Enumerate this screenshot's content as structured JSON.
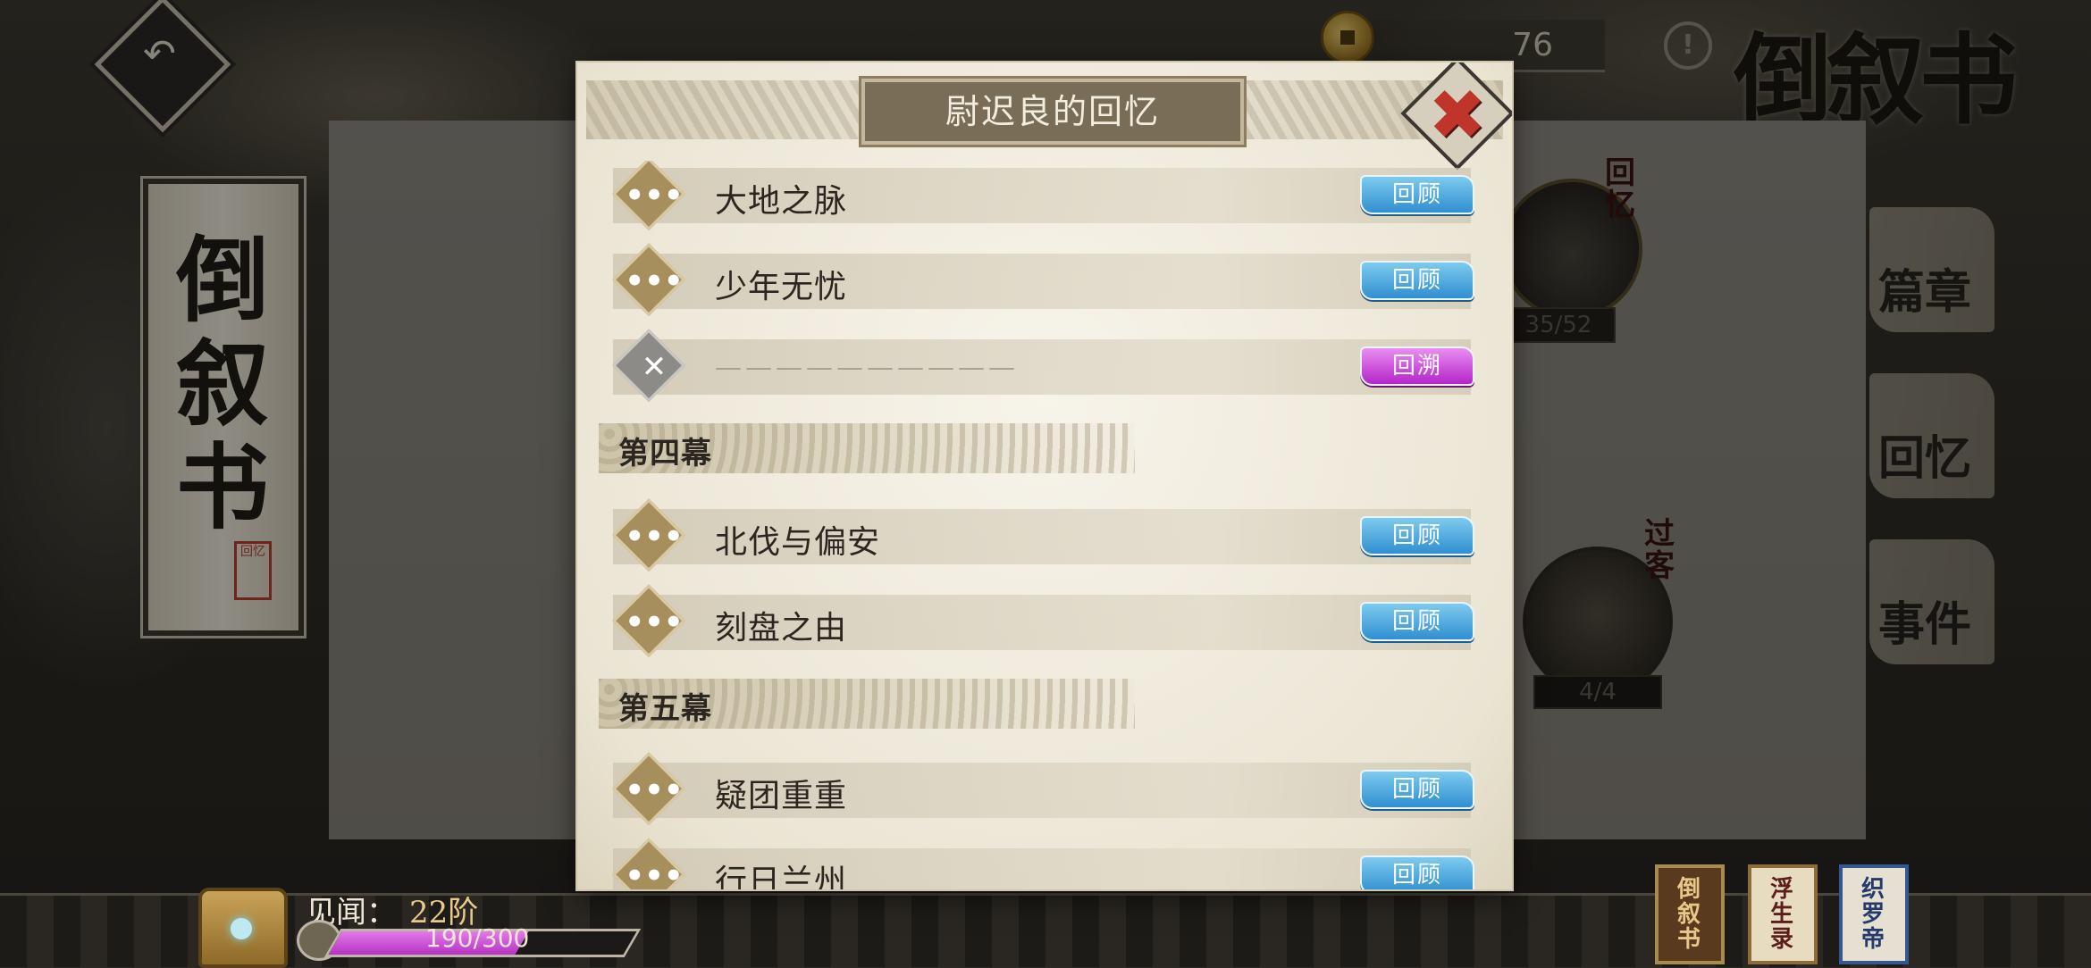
{
  "top": {
    "currency_value": "76",
    "info_glyph": "!",
    "book_title": "倒叙书",
    "back_glyph": "↶"
  },
  "left_scroll": {
    "title": "倒叙书",
    "seal": "回忆"
  },
  "characters": [
    {
      "tag": "回忆",
      "progress": "35/52"
    },
    {
      "tag": "过客",
      "progress": "4/4"
    }
  ],
  "side_menu": [
    "篇章",
    "回忆",
    "事件"
  ],
  "modal": {
    "title": "尉迟良的回忆",
    "close_glyph": "✖",
    "items": [
      {
        "type": "row",
        "name": "大地之脉",
        "button": "回顾",
        "locked": false
      },
      {
        "type": "row",
        "name": "少年无忧",
        "button": "回顾",
        "locked": false
      },
      {
        "type": "row",
        "name": "——————————",
        "button": "回溯",
        "locked": true
      },
      {
        "type": "section",
        "name": "第四幕"
      },
      {
        "type": "row",
        "name": "北伐与偏安",
        "button": "回顾",
        "locked": false
      },
      {
        "type": "row",
        "name": "刻盘之由",
        "button": "回顾",
        "locked": false
      },
      {
        "type": "section",
        "name": "第五幕"
      },
      {
        "type": "row",
        "name": "疑团重重",
        "button": "回顾",
        "locked": false
      },
      {
        "type": "row",
        "name": "行日兰州",
        "button": "回顾",
        "locked": false
      }
    ]
  },
  "bottom": {
    "exp_label": "见闻：",
    "exp_rank": "22阶",
    "exp_text": "190/300",
    "exp_progress": 0.633,
    "books": [
      "倒叙书",
      "浮生录",
      "织罗帝"
    ]
  }
}
